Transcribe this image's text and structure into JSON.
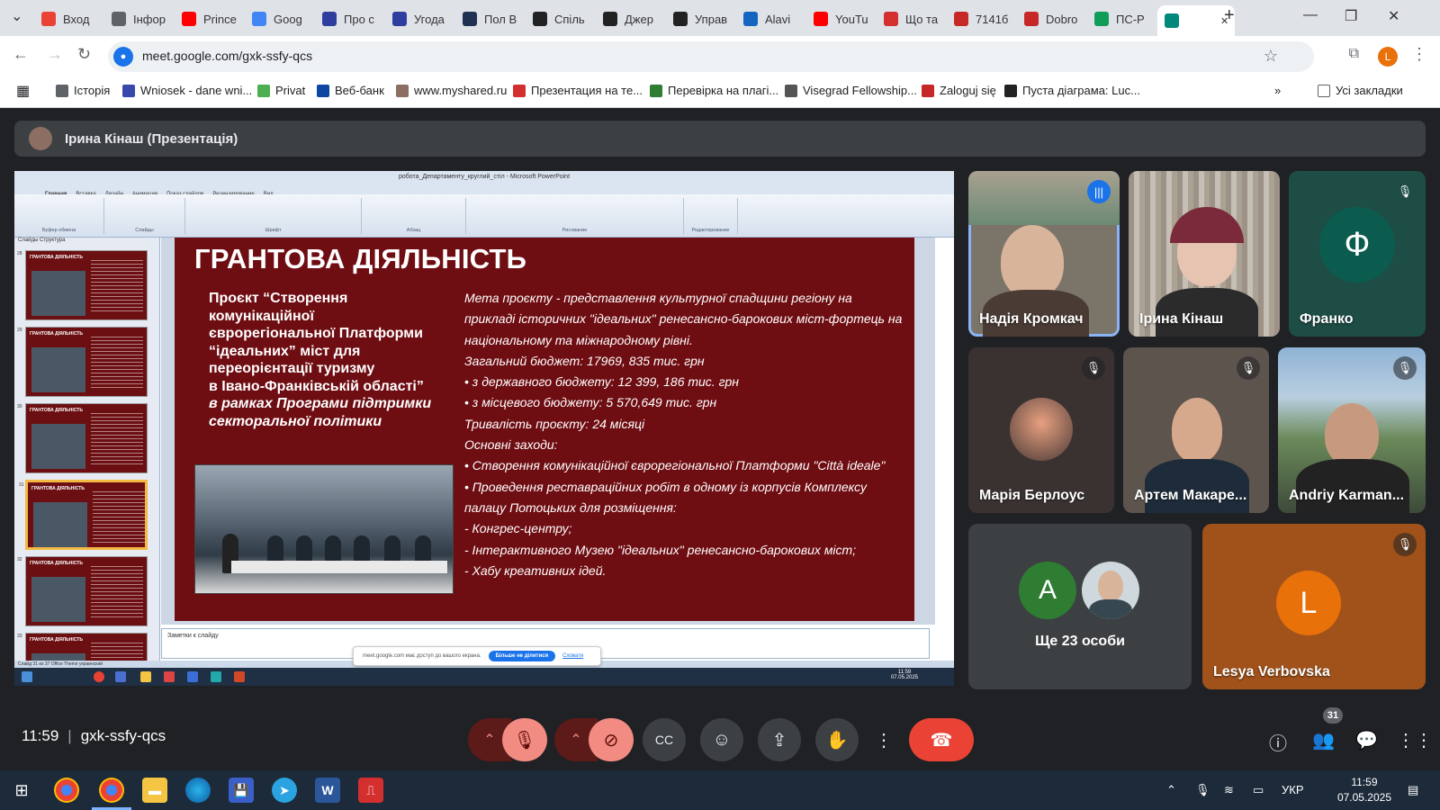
{
  "browser": {
    "tabs": [
      {
        "label": "Вход",
        "icon": "gmail-icon",
        "color": "#ea4335"
      },
      {
        "label": "Інфор",
        "icon": "globe-icon",
        "color": "#5f6368"
      },
      {
        "label": "Prince",
        "icon": "youtube-icon",
        "color": "#ff0000"
      },
      {
        "label": "Goog",
        "icon": "google-translate-icon",
        "color": "#4285f4"
      },
      {
        "label": "Про с",
        "icon": "docs-icon",
        "color": "#2f3e9e"
      },
      {
        "label": "Угода",
        "icon": "docs-icon",
        "color": "#2f3e9e"
      },
      {
        "label": "Пол В",
        "icon": "monitor-icon",
        "color": "#203050"
      },
      {
        "label": "Спіль",
        "icon": "app-icon",
        "color": "#222"
      },
      {
        "label": "Джер",
        "icon": "openai-icon",
        "color": "#222"
      },
      {
        "label": "Управ",
        "icon": "openai-icon",
        "color": "#222"
      },
      {
        "label": "Alavi",
        "icon": "diamond-icon",
        "color": "#1565c0"
      },
      {
        "label": "YouTu",
        "icon": "youtube-icon",
        "color": "#ff0000"
      },
      {
        "label": "Що та",
        "icon": "news-icon",
        "color": "#d32f2f"
      },
      {
        "label": "7141б",
        "icon": "pdf-icon",
        "color": "#c62828"
      },
      {
        "label": "Dobro",
        "icon": "pdf-icon",
        "color": "#c62828"
      },
      {
        "label": "ПС-Р",
        "icon": "sheets-icon",
        "color": "#0f9d58"
      },
      {
        "label": "",
        "icon": "meet-icon",
        "color": "#00897b"
      }
    ],
    "url": "meet.google.com/gxk-ssfy-qcs",
    "profile_initial": "L",
    "bookmarks": [
      {
        "label": "Історія",
        "color": "#5f6368"
      },
      {
        "label": "Wniosek - dane wni...",
        "color": "#3949ab"
      },
      {
        "label": "Privat",
        "color": "#4caf50"
      },
      {
        "label": "Веб-банк",
        "color": "#0d47a1"
      },
      {
        "label": "www.myshared.ru",
        "color": "#8d6e63"
      },
      {
        "label": "Презентация на те...",
        "color": "#d32f2f"
      },
      {
        "label": "Перевірка на плагі...",
        "color": "#2e7d32"
      },
      {
        "label": "Visegrad Fellowship...",
        "color": "#555"
      },
      {
        "label": "Zaloguj się",
        "color": "#c62828"
      },
      {
        "label": "Пуста діаграма: Luc...",
        "color": "#222"
      }
    ],
    "all_bookmarks": "Усі закладки"
  },
  "meet": {
    "presenter": "Ірина Кінаш (Презентація)",
    "meeting_code": "gxk-ssfy-qcs",
    "time": "11:59",
    "participants_count": "31",
    "more_people": "Ще 23 особи",
    "more_people_initial": "A",
    "tiles": [
      {
        "name": "Надія Кромкач"
      },
      {
        "name": "Ірина Кінаш"
      },
      {
        "name": "Франко",
        "initial": "Ф"
      },
      {
        "name": "Марія Берлоус"
      },
      {
        "name": "Артем Макаре..."
      },
      {
        "name": "Andriy Karman..."
      },
      {
        "name": "Lesya Verbovska",
        "initial": "L"
      }
    ]
  },
  "share": {
    "window_title": "робота_Департаменту_круглий_стіл - Microsoft PowerPoint",
    "ribbon_tabs": [
      "Главная",
      "Вставка",
      "Дизайн",
      "Анимация",
      "Показ слайдов",
      "Рецензирование",
      "Вид"
    ],
    "ribbon_groups": [
      "Буфер обмена",
      "Слайды",
      "Шрифт",
      "Абзац",
      "Рисование",
      "Редактирование"
    ],
    "side_tabs": "Слайды   Структура",
    "thumbs": [
      {
        "num": "28",
        "title": "ГРАНТОВА ДІЯЛЬНІСТЬ"
      },
      {
        "num": "29",
        "title": "ГРАНТОВА ДІЯЛЬНІСТЬ"
      },
      {
        "num": "30",
        "title": "ГРАНТОВА ДІЯЛЬНІСТЬ"
      },
      {
        "num": "31",
        "title": "ГРАНТОВА ДІЯЛЬНІСТЬ"
      },
      {
        "num": "32",
        "title": "ГРАНТОВА ДІЯЛЬНІСТЬ"
      },
      {
        "num": "33",
        "title": "ГРАНТОВА ДІЯЛЬНІСТЬ"
      }
    ],
    "slide": {
      "heading": "ГРАНТОВА ДІЯЛЬНІСТЬ",
      "project_line1": "Проєкт “Створення",
      "project_line2": "комунікаційної",
      "project_line3": "єврорегіональної Платформи",
      "project_line4": "“ідеальних” міст для",
      "project_line5": "переорієнтації туризму",
      "project_line6": "в Івано-Франківській області”",
      "project_line7": "в рамках Програми підтримки",
      "project_line8": "секторальної політики",
      "lines": [
        "Мета проєкту - представлення культурної спадщини регіону на",
        "прикладі історичних \"ідеальних\" ренесансно-барокових міст-фортець на",
        "національному та міжнародному рівні.",
        "Загальний бюджет:    17969, 835 тис. грн",
        "•  з державного бюджету: 12 399, 186 тис. грн",
        "•  з місцевого бюджету: 5 570,649 тис. грн",
        "      Тривалість проєкту: 24 місяці",
        "      Основні заходи:",
        "•   Створення комунікаційної єврорегіональної Платформи \"Città ideale\"",
        "•   Проведення реставраційних робіт в одному із корпусів  Комплексу",
        "     палацу Потоцьких для розміщення:",
        "   - Конгрес-центру;",
        "   - Інтерактивного Музею \"ідеальних\" ренесансно-барокових міст;",
        "   -  Хабу креативних ідей."
      ]
    },
    "notes_placeholder": "Заметки к слайду",
    "status": "Слайд 31 из 37    Office Theme    украинский",
    "banner_text": "meet.google.com має доступ до вашого екрана.",
    "banner_stop": "Більше не ділитися",
    "banner_hide": "Сховати",
    "inner_clock_time": "11:59",
    "inner_clock_date": "07.05.2025"
  },
  "taskbar": {
    "lang": "УКР",
    "time": "11:59",
    "date": "07.05.2025"
  },
  "colors": {
    "slide_bg": "#6e0d12",
    "meet_bg": "#202124",
    "end_call": "#ea4335",
    "speaking_outline": "#8ab4f8"
  }
}
